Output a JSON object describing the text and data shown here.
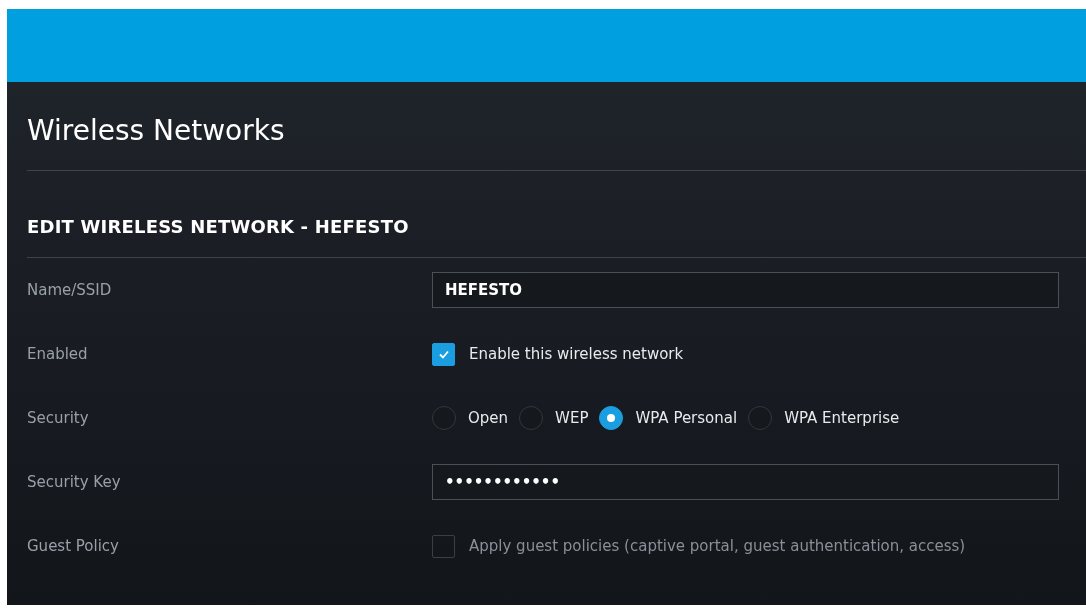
{
  "page": {
    "title": "Wireless Networks"
  },
  "form": {
    "heading": "EDIT WIRELESS NETWORK - HEFESTO",
    "rows": [
      {
        "kind": "text",
        "label": "Name/SSID",
        "value": "HEFESTO"
      },
      {
        "kind": "checkbox",
        "label": "Enabled",
        "text": "Enable this wireless network",
        "checked": true
      },
      {
        "kind": "radio",
        "label": "Security",
        "options": [
          {
            "label": "Open",
            "selected": false
          },
          {
            "label": "WEP",
            "selected": false
          },
          {
            "label": "WPA Personal",
            "selected": true
          },
          {
            "label": "WPA Enterprise",
            "selected": false
          }
        ]
      },
      {
        "kind": "text",
        "label": "Security Key",
        "value": "••••••••••••"
      },
      {
        "kind": "checkbox",
        "label": "Guest Policy",
        "text": "Apply guest policies (captive portal, guest authentication, access)",
        "checked": false
      }
    ]
  }
}
